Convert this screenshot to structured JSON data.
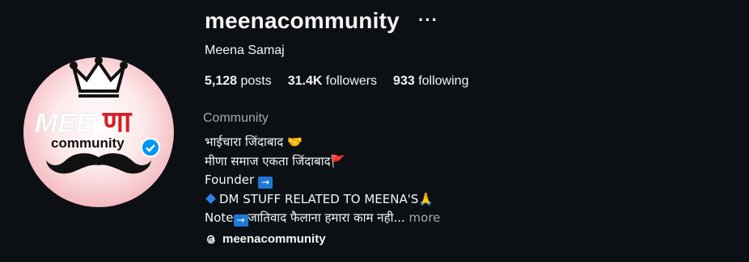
{
  "profile": {
    "username": "meenacommunity",
    "more_icon": "···",
    "full_name": "Meena Samaj",
    "stats": {
      "posts_count": "5,128",
      "posts_label": "posts",
      "followers_count": "31.4K",
      "followers_label": "followers",
      "following_count": "933",
      "following_label": "following"
    },
    "category": "Community",
    "bio": {
      "line1": "भाईचारा जिंदाबाद",
      "line1_emoji": "🤝",
      "line2": "मीणा समाज एकता जिंदाबाद",
      "line2_emoji": "🚩",
      "line3": "Founder",
      "arrow": "→",
      "line4": "DM STUFF RELATED TO MEENA'S",
      "line4_emoji": "🙏",
      "line5_prefix": "Note",
      "line5_text": "जातिवाद फैलाना हमारा काम नही...",
      "more": "more"
    },
    "threads_handle": "meenacommunity"
  },
  "avatar": {
    "logo_text_latin": "MEE",
    "logo_text_devanagari": "णा",
    "logo_sub": "community",
    "icons": [
      "crown-icon",
      "mustache-icon",
      "verified-badge-icon"
    ]
  },
  "colors": {
    "background": "#0c1014",
    "text": "#f5f5f5",
    "secondary": "#a8a8a8",
    "brand_red": "#d42027",
    "verified_blue": "#0095f6"
  }
}
